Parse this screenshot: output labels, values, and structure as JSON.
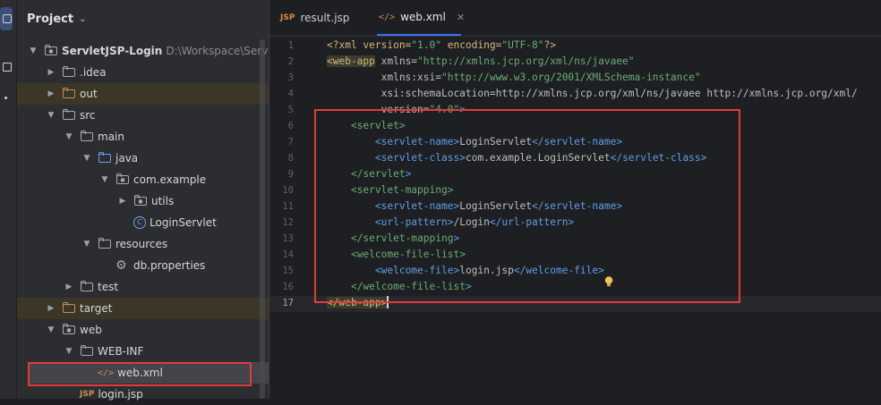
{
  "project_panel": {
    "title": "Project",
    "tree": [
      {
        "label": "ServletJSP-Login",
        "detail": "D:\\Workspace\\ServletJSP"
      },
      {
        "label": ".idea"
      },
      {
        "label": "out"
      },
      {
        "label": "src"
      },
      {
        "label": "main"
      },
      {
        "label": "java"
      },
      {
        "label": "com.example"
      },
      {
        "label": "utils"
      },
      {
        "label": "LoginServlet"
      },
      {
        "label": "resources"
      },
      {
        "label": "db.properties"
      },
      {
        "label": "test"
      },
      {
        "label": "target"
      },
      {
        "label": "web"
      },
      {
        "label": "WEB-INF"
      },
      {
        "label": "web.xml"
      },
      {
        "label": "login.jsp"
      }
    ]
  },
  "editor": {
    "tabs": [
      {
        "label": "result.jsp",
        "icon": "jsp-icon",
        "active": false
      },
      {
        "label": "web.xml",
        "icon": "xml-icon",
        "active": true
      }
    ],
    "current_line": 17,
    "lines": [
      {
        "n": "1",
        "text": "<?xml version=\"1.0\" encoding=\"UTF-8\"?>"
      },
      {
        "n": "2",
        "text": "<web-app xmlns=\"http://xmlns.jcp.org/xml/ns/javaee\""
      },
      {
        "n": "3",
        "text": "         xmlns:xsi=\"http://www.w3.org/2001/XMLSchema-instance\""
      },
      {
        "n": "4",
        "text": "         xsi:schemaLocation=\"http://xmlns.jcp.org/xml/ns/javaee http://xmlns.jcp.org/xml/"
      },
      {
        "n": "5",
        "text": "         version=\"4.0\">"
      },
      {
        "n": "6",
        "text": "    <servlet>"
      },
      {
        "n": "7",
        "text": "        <servlet-name>LoginServlet</servlet-name>"
      },
      {
        "n": "8",
        "text": "        <servlet-class>com.example.LoginServlet</servlet-class>"
      },
      {
        "n": "9",
        "text": "    </servlet>"
      },
      {
        "n": "10",
        "text": "    <servlet-mapping>"
      },
      {
        "n": "11",
        "text": "        <servlet-name>LoginServlet</servlet-name>"
      },
      {
        "n": "12",
        "text": "        <url-pattern>/Login</url-pattern>"
      },
      {
        "n": "13",
        "text": "    </servlet-mapping>"
      },
      {
        "n": "14",
        "text": "    <welcome-file-list>"
      },
      {
        "n": "15",
        "text": "        <welcome-file>login.jsp</welcome-file>"
      },
      {
        "n": "16",
        "text": "    </welcome-file-list>"
      },
      {
        "n": "17",
        "text": "</web-app>"
      }
    ]
  },
  "colors": {
    "accent": "#3574f0",
    "annotation_red": "#e33b3b"
  }
}
